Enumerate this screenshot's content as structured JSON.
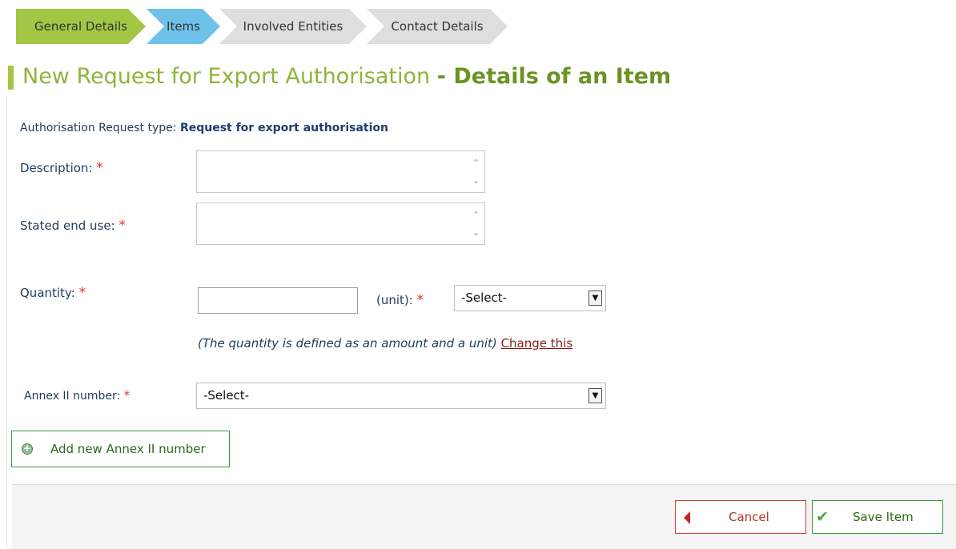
{
  "wizard": {
    "steps": [
      {
        "label": "General Details",
        "state": "done"
      },
      {
        "label": "Items",
        "state": "active"
      },
      {
        "label": "Involved Entities",
        "state": "pending"
      },
      {
        "label": "Contact Details",
        "state": "pending"
      }
    ]
  },
  "header": {
    "title": "New Request for Export Authorisation",
    "subtitle": "- Details of an Item"
  },
  "form": {
    "request_type_label": "Authorisation Request type:",
    "request_type_value": "Request for export authorisation",
    "description_label": "Description",
    "stated_end_use_label": "Stated end use",
    "colon": ":",
    "required_mark": "*",
    "quantity_label": "Quantity:",
    "quantity_value": "",
    "unit_label": "(unit)",
    "unit_selected": "-Select-",
    "quantity_hint": "(The quantity is defined as an amount and a unit)",
    "change_link": "Change this",
    "annex_label": "Annex II number:",
    "annex_selected": "-Select-",
    "add_annex_label": "Add new Annex II  number"
  },
  "footer": {
    "cancel_label": "Cancel",
    "save_label": "Save Item"
  },
  "colors": {
    "accent_green": "#a3c644",
    "active_blue": "#6ec2ea",
    "required_red": "#e0302f",
    "cancel_red": "#d64030",
    "save_green": "#3a9a3a"
  },
  "icons": {
    "scroll_up": "up-chevron-icon",
    "scroll_down": "down-chevron-icon",
    "dropdown": "chevron-down-icon",
    "add": "plus-circle-icon",
    "cancel": "triangle-left-icon",
    "save": "check-icon"
  }
}
